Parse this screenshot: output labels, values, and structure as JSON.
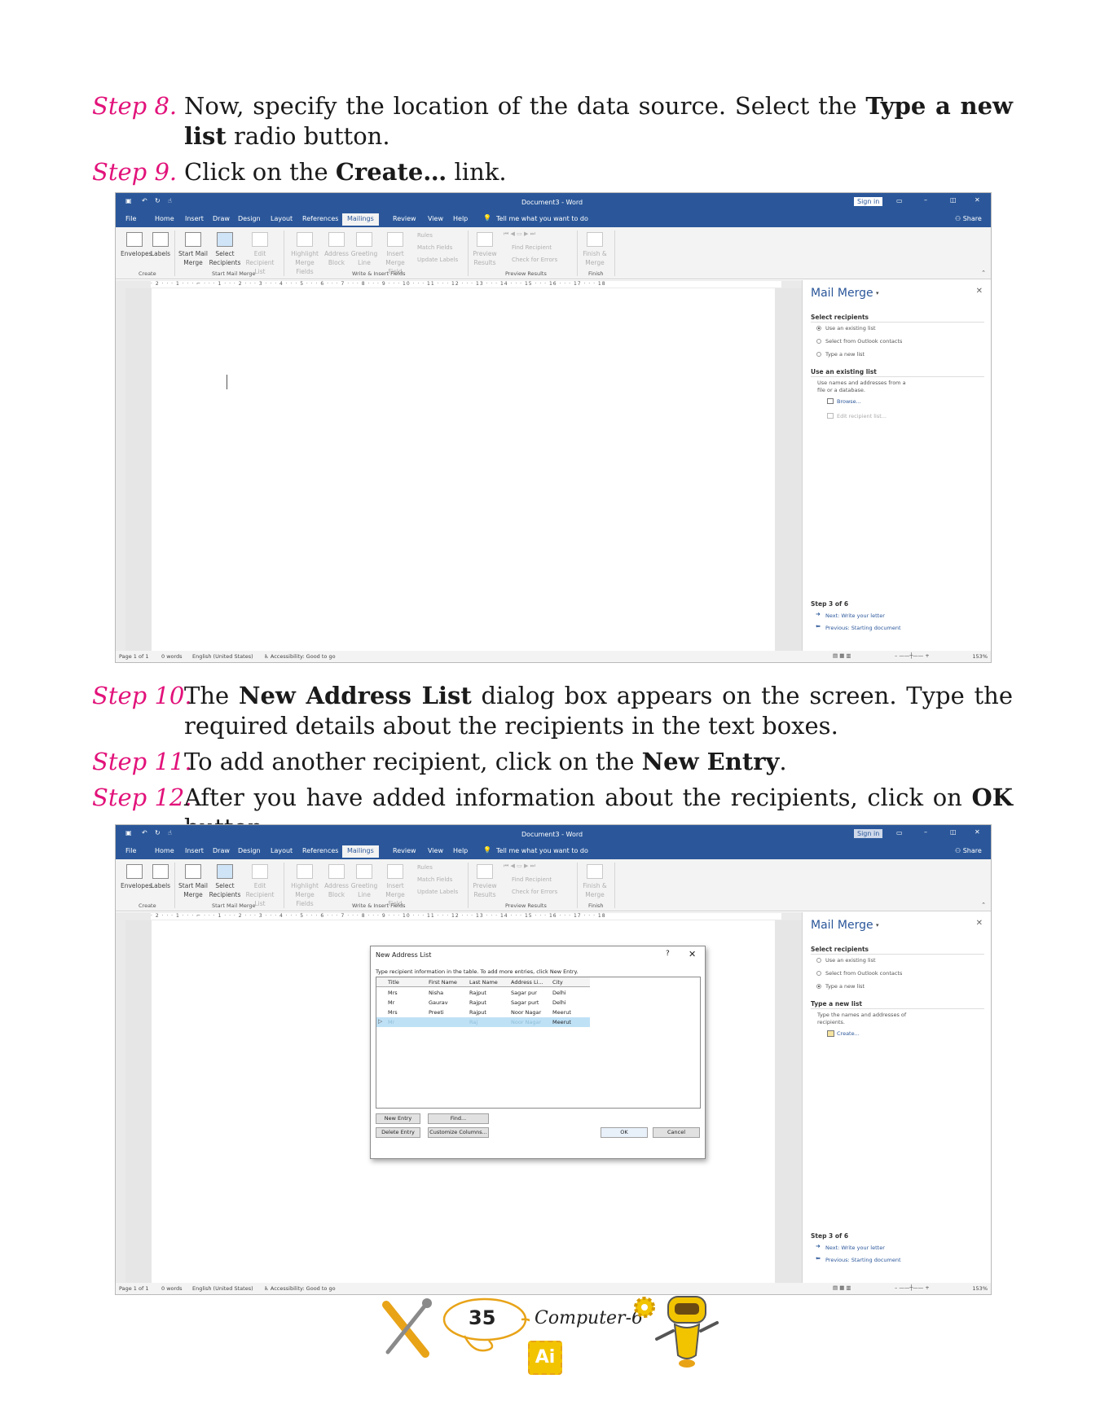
{
  "steps": [
    {
      "num": "Step 8.",
      "pre": "Now, specify the location of the data source. Select the ",
      "bold": "Type a new list",
      "post": " radio button."
    },
    {
      "num": "Step 9.",
      "pre": "Click on the ",
      "bold": "Create…",
      "post": " link."
    },
    {
      "num": "Step 10.",
      "pre": "The ",
      "bold": "New Address List",
      "post": " dialog box appears on the screen. Type the required details about the recipients in the text boxes."
    },
    {
      "num": "Step 11.",
      "pre": "To add another recipient, click on the ",
      "bold": "New Entry",
      "post": "."
    },
    {
      "num": "Step 12.",
      "pre": "After you have added information about the recipients, click on ",
      "bold": "OK",
      "post": " button."
    }
  ],
  "word": {
    "title": "Document3 - Word",
    "sign_in": "Sign in",
    "share": "Share",
    "tabs": [
      "File",
      "Home",
      "Insert",
      "Draw",
      "Design",
      "Layout",
      "References",
      "Mailings",
      "Review",
      "View",
      "Help"
    ],
    "tell_me": "Tell me what you want to do",
    "ribbon": {
      "envelopes": "Envelopes",
      "labels": "Labels",
      "start_mail_merge": "Start Mail Merge",
      "select_recipients": "Select Recipients",
      "edit_recipient_list": "Edit Recipient List",
      "highlight_merge_fields": "Highlight Merge Fields",
      "address_block": "Address Block",
      "greeting_line": "Greeting Line",
      "insert_merge_field": "Insert Merge Field",
      "rules": "Rules",
      "match_fields": "Match Fields",
      "update_labels": "Update Labels",
      "preview_results": "Preview Results",
      "find_recipient": "Find Recipient",
      "check_for_errors": "Check for Errors",
      "finish_merge": "Finish & Merge",
      "groups": [
        "Create",
        "Start Mail Merge",
        "Write & Insert Fields",
        "Preview Results",
        "Finish"
      ]
    },
    "ruler_text": "· 2 · · · 1 · · · ⌐ · · · 1 · · · 2 · · · 3 · · · 4 · · · 5 · · · 6 · · · 7 · · · 8 · · · 9 · · · 10 · · · 11 · · · 12 · · · 13 · · · 14 · · · 15 · · · 16 · · · 17 · · · 18",
    "status": {
      "page": "Page 1 of 1",
      "words": "0 words",
      "language": "English (United States)",
      "accessibility": "Accessibility: Good to go",
      "zoom": "153%"
    }
  },
  "pane1": {
    "title": "Mail Merge",
    "select_head": "Select recipients",
    "options": [
      "Use an existing list",
      "Select from Outlook contacts",
      "Type a new list"
    ],
    "section_head": "Use an existing list",
    "section_desc": "Use names and addresses from a file or a database.",
    "link1": "Browse...",
    "link2": "Edit recipient list...",
    "step": "Step 3 of 6",
    "next": "Next: Write your letter",
    "prev": "Previous: Starting document"
  },
  "pane2": {
    "title": "Mail Merge",
    "select_head": "Select recipients",
    "options": [
      "Use an existing list",
      "Select from Outlook contacts",
      "Type a new list"
    ],
    "section_head": "Type a new list",
    "section_desc": "Type the names and addresses of recipients.",
    "link1": "Create...",
    "step": "Step 3 of 6",
    "next": "Next: Write your letter",
    "prev": "Previous: Starting document"
  },
  "dialog": {
    "title": "New Address List",
    "help": "?",
    "hint": "Type recipient information in the table.  To add more entries, click New Entry.",
    "columns": [
      "Title",
      "First Name",
      "Last Name",
      "Address Li...",
      "City"
    ],
    "rows": [
      [
        "Mrs",
        "Nisha",
        "Rajput",
        "Sagar pur",
        "Delhi"
      ],
      [
        "Mr",
        "Gaurav",
        "Rajput",
        "Sagar purt",
        "Delhi"
      ],
      [
        "Mrs",
        "Preeti",
        "Rajput",
        "Noor Nagar",
        "Meerut"
      ],
      [
        "Mr",
        "",
        "Raj",
        "Noor Nagar",
        "Meerut"
      ]
    ],
    "buttons": {
      "new_entry": "New Entry",
      "find": "Find...",
      "delete_entry": "Delete Entry",
      "customize": "Customize Columns...",
      "ok": "OK",
      "cancel": "Cancel"
    }
  },
  "footer": {
    "page_number": "35",
    "book": "Computer-6",
    "badge": "Ai"
  }
}
